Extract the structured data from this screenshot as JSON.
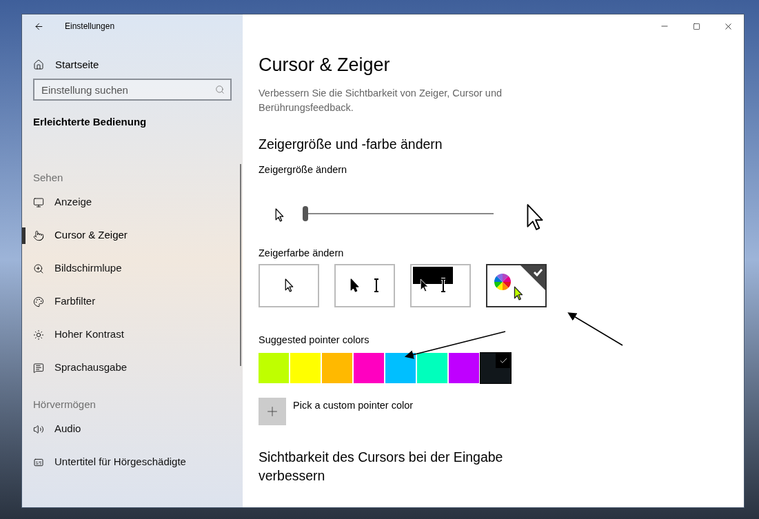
{
  "window": {
    "title": "Einstellungen"
  },
  "sidebar": {
    "home": "Startseite",
    "search": {
      "placeholder": "Einstellung suchen"
    },
    "category": "Erleichterte Bedienung",
    "sections": [
      {
        "heading": "Sehen",
        "items": [
          {
            "label": "Anzeige",
            "kind": "display",
            "selected": false
          },
          {
            "label": "Cursor & Zeiger",
            "kind": "pointer",
            "selected": true
          },
          {
            "label": "Bildschirmlupe",
            "kind": "magnifier",
            "selected": false
          },
          {
            "label": "Farbfilter",
            "kind": "palette",
            "selected": false
          },
          {
            "label": "Hoher Kontrast",
            "kind": "contrast",
            "selected": false
          },
          {
            "label": "Sprachausgabe",
            "kind": "narrator",
            "selected": false
          }
        ]
      },
      {
        "heading": "Hörvermögen",
        "items": [
          {
            "label": "Audio",
            "kind": "audio",
            "selected": false
          },
          {
            "label": "Untertitel für Hörgeschädigte",
            "kind": "captions",
            "selected": false
          }
        ]
      }
    ]
  },
  "content": {
    "title": "Cursor & Zeiger",
    "description": "Verbessern Sie die Sichtbarkeit von Zeiger, Cursor und Berührungsfeedback.",
    "section_heading": "Zeigergröße und -farbe ändern",
    "size_label": "Zeigergröße ändern",
    "size_slider": {
      "level": 0
    },
    "color_label": "Zeigerfarbe ändern",
    "color_options": [
      {
        "kind": "white",
        "selected": false
      },
      {
        "kind": "black",
        "selected": false
      },
      {
        "kind": "inverted",
        "selected": false
      },
      {
        "kind": "custom",
        "selected": true
      }
    ],
    "suggested_label": "Suggested pointer colors",
    "swatches": [
      {
        "color": "#bfff00",
        "selected": false
      },
      {
        "color": "#ffff00",
        "selected": false
      },
      {
        "color": "#ffb900",
        "selected": false
      },
      {
        "color": "#ff00c0",
        "selected": false
      },
      {
        "color": "#00bfff",
        "selected": false
      },
      {
        "color": "#00ffbc",
        "selected": false
      },
      {
        "color": "#bf00ff",
        "selected": false
      },
      {
        "color": "#11171b",
        "selected": true
      }
    ],
    "custom_color_label": "Pick a custom pointer color",
    "next_heading": "Sichtbarkeit des Cursors bei der Eingabe verbessern"
  }
}
